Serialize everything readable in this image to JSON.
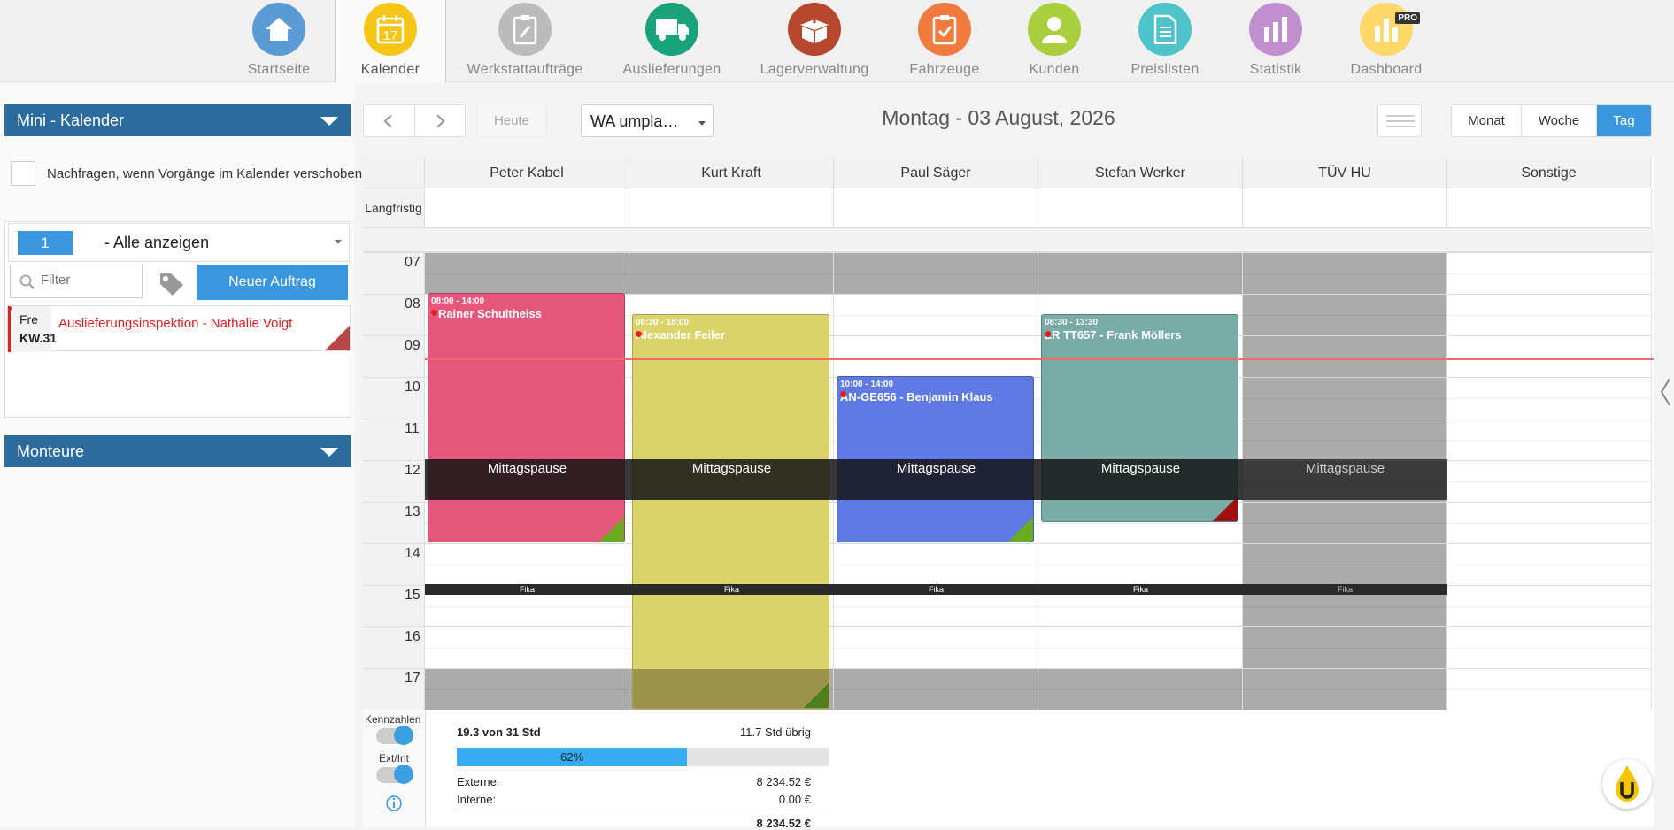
{
  "nav": [
    {
      "label": "Startseite",
      "color": "#5b9bd5",
      "icon": "home-icon"
    },
    {
      "label": "Kalender",
      "color": "#f5c518",
      "icon": "calendar-icon",
      "badge": "17"
    },
    {
      "label": "Werkstattaufträge",
      "color": "#bbbbbb",
      "icon": "clipboard-wrench-icon"
    },
    {
      "label": "Auslieferungen",
      "color": "#1aa37a",
      "icon": "truck-icon"
    },
    {
      "label": "Lagerverwaltung",
      "color": "#b5472f",
      "icon": "box-icon"
    },
    {
      "label": "Fahrzeuge",
      "color": "#f07b3f",
      "icon": "clipboard-check-icon"
    },
    {
      "label": "Kunden",
      "color": "#a9cf3f",
      "icon": "user-icon"
    },
    {
      "label": "Preislisten",
      "color": "#4ec3c9",
      "icon": "document-icon"
    },
    {
      "label": "Statistik",
      "color": "#c08fcf",
      "icon": "bar-chart-icon"
    },
    {
      "label": "Dashboard",
      "color": "#fdd86b",
      "icon": "dashboard-icon",
      "pro": "PRO"
    }
  ],
  "sidebar": {
    "mini_title": "Mini - Kalender",
    "ask_label": "Nachfragen, wenn Vorgänge im Kalender verschoben",
    "filter_num": "1",
    "filter_sel": "- Alle anzeigen",
    "filter_placeholder": "Filter",
    "new_order": "Neuer Auftrag",
    "item_day": "Fre",
    "item_week": "KW.31",
    "item_text": "Auslieferungsinspektion - Nathalie Voigt",
    "monteure_title": "Monteure"
  },
  "toolbar": {
    "today": "Heute",
    "view_select": "WA umpla…",
    "date_title": "Montag - 03 August, 2026",
    "views": [
      "Monat",
      "Woche",
      "Tag"
    ],
    "active_view": "Tag"
  },
  "columns": [
    "Peter Kabel",
    "Kurt Kraft",
    "Paul Säger",
    "Stefan Werker",
    "TÜV HU",
    "Sonstige"
  ],
  "longterm": "Langfristig",
  "hours": [
    "07",
    "08",
    "09",
    "10",
    "11",
    "12",
    "13",
    "14",
    "15",
    "16",
    "17"
  ],
  "events": [
    {
      "time": "08:00 - 14:00",
      "name": "- Rainer Schultheiss",
      "color": "#e5577a",
      "corner": "#6aaa1e"
    },
    {
      "time": "08:30 - 18:00",
      "name": "Alexander Feiler",
      "color": "#dbd46a",
      "corner": "#4e7f1a"
    },
    {
      "time": "10:00 - 14:00",
      "name": "AN-GE656 - Benjamin Klaus",
      "color": "#5f7be3",
      "corner": "#6aaa1e"
    },
    {
      "time": "08:30 - 13:30",
      "name": "LR TT657 - Frank Möllers",
      "color": "#79aca6",
      "corner": "#a01010"
    }
  ],
  "break_label": "Mittagspause",
  "fika_label": "Fika",
  "stats": {
    "kennzahlen": "Kennzahlen",
    "extint": "Ext/Int",
    "hours_used": "19.3 von 31 Std",
    "hours_left": "11.7 Std übrig",
    "progress": 0.62,
    "progress_label": "62%",
    "ext_label": "Externe:",
    "ext_val": "8 234.52 €",
    "int_label": "Interne:",
    "int_val": "0.00 €",
    "total_val": "8 234.52 €"
  }
}
